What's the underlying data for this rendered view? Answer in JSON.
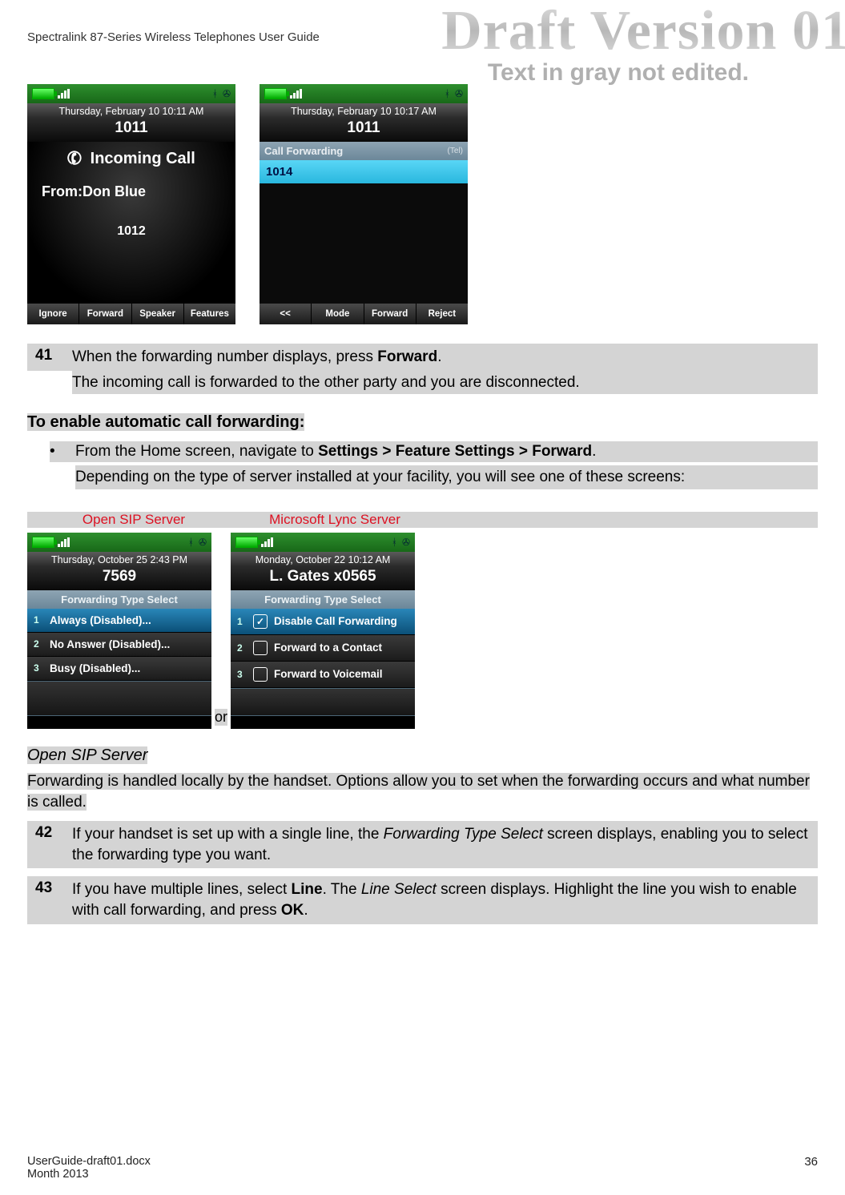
{
  "header": {
    "title": "Spectralink 87-Series Wireless Telephones User Guide"
  },
  "watermark": {
    "main": "Draft Version 01",
    "sub": "Text in gray not edited."
  },
  "phoneA": {
    "datetime": "Thursday, February 10 10:11 AM",
    "ext": "1011",
    "incoming": "Incoming Call",
    "from": "From:Don Blue",
    "caller_num": "1012",
    "softkeys": [
      "Ignore",
      "Forward",
      "Speaker",
      "Features"
    ]
  },
  "phoneB": {
    "datetime": "Thursday, February 10 10:17 AM",
    "ext": "1011",
    "cf_title": "Call Forwarding",
    "cf_tag": "(Tel)",
    "input": "1014",
    "softkeys": [
      "<<",
      "Mode",
      "Forward",
      "Reject"
    ]
  },
  "step41": {
    "num": "41",
    "line1_a": "When the forwarding number displays, press ",
    "line1_b": "Forward",
    "line1_c": ".",
    "line2": "The incoming call is forwarded to the other party and you are disconnected."
  },
  "enable_hd": "To enable automatic call forwarding:",
  "enable_bullet": {
    "a": "From the Home screen, navigate to ",
    "b": "Settings > Feature Settings > Forward",
    "c": ".",
    "sub": "Depending on the type of server installed at your facility, you will see one of these screens:"
  },
  "labels": {
    "open": "Open SIP Server",
    "lync": "Microsoft Lync Server"
  },
  "or": "or",
  "phoneC": {
    "datetime": "Thursday, October 25 2:43 PM",
    "ext": "7569",
    "menu_hd": "Forwarding Type Select",
    "rows": [
      {
        "n": "1",
        "label": "Always (Disabled)..."
      },
      {
        "n": "2",
        "label": "No Answer (Disabled)..."
      },
      {
        "n": "3",
        "label": "Busy (Disabled)..."
      }
    ]
  },
  "phoneD": {
    "datetime": "Monday, October 22 10:12 AM",
    "ext": "L. Gates x0565",
    "menu_hd": "Forwarding Type Select",
    "rows": [
      {
        "n": "1",
        "label": "Disable Call Forwarding"
      },
      {
        "n": "2",
        "label": "Forward to a Contact"
      },
      {
        "n": "3",
        "label": "Forward to Voicemail"
      }
    ]
  },
  "open_sip_hd": "Open SIP Server",
  "open_sip_p": "Forwarding is handled locally by the handset. Options allow you to set when the forwarding occurs and what number is called.",
  "step42": {
    "num": "42",
    "a": "If your handset is set up with a single line, the ",
    "b": "Forwarding Type Select",
    "c": " screen displays, enabling you to select the forwarding type you want."
  },
  "step43": {
    "num": "43",
    "a": "If you have multiple lines, select ",
    "b": "Line",
    "c": ". The ",
    "d": "Line Select",
    "e": " screen displays. Highlight the line you wish to enable with call forwarding, and press ",
    "f": "OK",
    "g": "."
  },
  "footer": {
    "doc": "UserGuide-draft01.docx",
    "date": "Month 2013",
    "page": "36"
  }
}
